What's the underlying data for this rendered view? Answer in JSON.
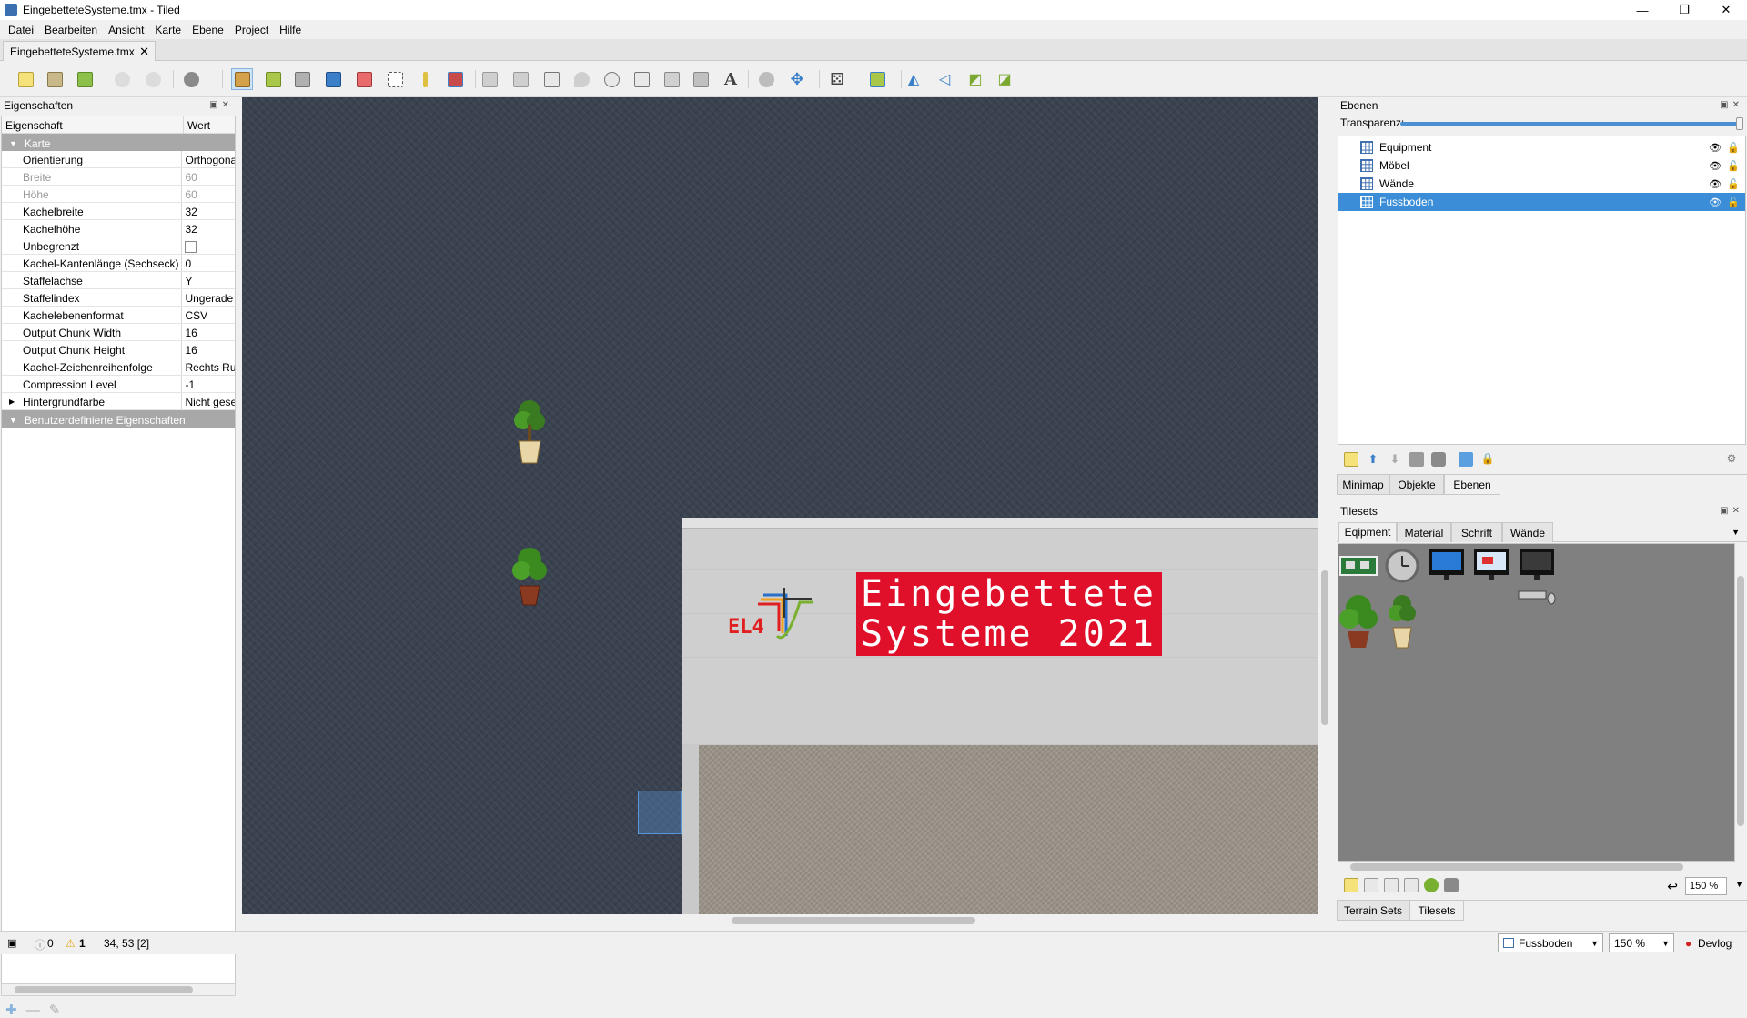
{
  "window": {
    "title": "EingebetteteSysteme.tmx - Tiled",
    "controls": [
      "—",
      "❐",
      "✕"
    ]
  },
  "menu": [
    "Datei",
    "Bearbeiten",
    "Ansicht",
    "Karte",
    "Ebene",
    "Project",
    "Hilfe"
  ],
  "doc_tab": {
    "label": "EingebetteteSysteme.tmx",
    "close": "✕"
  },
  "properties": {
    "title": "Eigenschaften",
    "col_property": "Eigenschaft",
    "col_value": "Wert",
    "group_map": "Karte",
    "rows": [
      {
        "k": "Orientierung",
        "v": "Orthogonal",
        "disabled": false
      },
      {
        "k": "Breite",
        "v": "60",
        "disabled": true
      },
      {
        "k": "Höhe",
        "v": "60",
        "disabled": true
      },
      {
        "k": "Kachelbreite",
        "v": "32",
        "disabled": false
      },
      {
        "k": "Kachelhöhe",
        "v": "32",
        "disabled": false
      },
      {
        "k": "Unbegrenzt",
        "v": "",
        "disabled": false
      },
      {
        "k": "Kachel-Kantenlänge (Sechseck)",
        "v": "0",
        "disabled": false
      },
      {
        "k": "Staffelachse",
        "v": "Y",
        "disabled": false
      },
      {
        "k": "Staffelindex",
        "v": "Ungerade",
        "disabled": false
      },
      {
        "k": "Kachelebenenformat",
        "v": "CSV",
        "disabled": false
      },
      {
        "k": "Output Chunk Width",
        "v": "16",
        "disabled": false
      },
      {
        "k": "Output Chunk Height",
        "v": "16",
        "disabled": false
      },
      {
        "k": "Kachel-Zeichenreihenfolge",
        "v": "Rechts Runter",
        "disabled": false
      },
      {
        "k": "Compression Level",
        "v": "-1",
        "disabled": false
      },
      {
        "k": "Hintergrundfarbe",
        "v": "Nicht gesetzt",
        "disabled": false
      }
    ],
    "group_custom": "Benutzerdefinierte Eigenschaften"
  },
  "map": {
    "banner_text": "Eingebettete\nSysteme 2021",
    "logo_text": "EL4"
  },
  "layers": {
    "title": "Ebenen",
    "opacity_label": "Transparenz:",
    "opacity": 1.0,
    "items": [
      {
        "name": "Equipment",
        "selected": false
      },
      {
        "name": "Möbel",
        "selected": false
      },
      {
        "name": "Wände",
        "selected": false
      },
      {
        "name": "Fussboden",
        "selected": true
      }
    ],
    "tabs": [
      "Minimap",
      "Objekte",
      "Ebenen"
    ],
    "active_tab": "Ebenen"
  },
  "tilesets": {
    "title": "Tilesets",
    "tabs": [
      "Eqipment",
      "Material",
      "Schrift",
      "Wände"
    ],
    "active_tab": "Eqipment",
    "zoom": "150 %",
    "bottom_tabs": [
      "Terrain Sets",
      "Tilesets"
    ]
  },
  "status": {
    "errors": "0",
    "warnings": "1",
    "coords": "34, 53 [2]",
    "layer_combo": "Fussboden",
    "zoom_combo": "150 %",
    "devlog": "Devlog"
  },
  "colors": {
    "accent": "#3a8dd6",
    "banner": "#e0102a",
    "map_bg": "#3a4250"
  }
}
